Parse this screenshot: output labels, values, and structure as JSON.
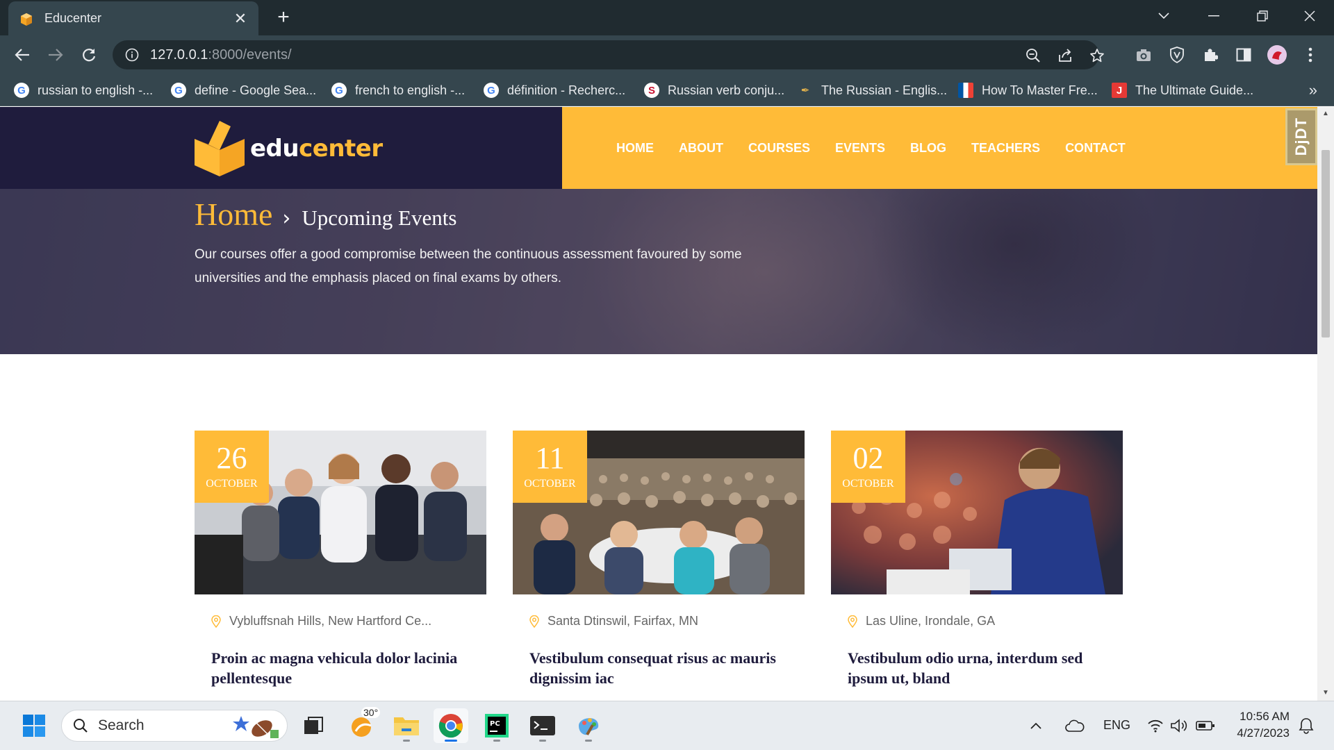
{
  "browser": {
    "tab_title": "Educenter",
    "url_host": "127.0.0.1",
    "url_path": ":8000/events/",
    "bookmarks": [
      {
        "label": "russian to english -...",
        "icon": "google-icon"
      },
      {
        "label": "define - Google Sea...",
        "icon": "google-icon"
      },
      {
        "label": "french to english -...",
        "icon": "google-icon"
      },
      {
        "label": "définition - Recherc...",
        "icon": "google-icon"
      },
      {
        "label": "Russian verb conju...",
        "icon": "reverso-icon"
      },
      {
        "label": "The Russian - Englis...",
        "icon": "pen-icon"
      },
      {
        "label": "How To Master Fre...",
        "icon": "french-flag-icon"
      },
      {
        "label": "The Ultimate Guide...",
        "icon": "j-icon"
      }
    ],
    "bookmarks_more": "»"
  },
  "site": {
    "logo_part1": "edu",
    "logo_part2": "center",
    "nav": [
      "HOME",
      "ABOUT",
      "COURSES",
      "EVENTS",
      "BLOG",
      "TEACHERS",
      "CONTACT"
    ],
    "djdt_label": "DjDT",
    "colors": {
      "primary": "#ffbb38",
      "dark": "#1f1c3d"
    }
  },
  "hero": {
    "crumb_home": "Home",
    "crumb_current": "Upcoming Events",
    "description": "Our courses offer a good compromise between the continuous assessment favoured by some universities and the emphasis placed on final exams by others."
  },
  "events": [
    {
      "day": "26",
      "month": "OCTOBER",
      "location": "Vybluffsnah Hills, New Hartford Ce...",
      "title": "Proin ac magna vehicula dolor lacinia pellentesque"
    },
    {
      "day": "11",
      "month": "OCTOBER",
      "location": "Santa Dtinswil, Fairfax, MN",
      "title": "Vestibulum consequat risus ac mauris dignissim iac"
    },
    {
      "day": "02",
      "month": "OCTOBER",
      "location": "Las Uline, Irondale, GA",
      "title": "Vestibulum odio urna, interdum sed ipsum ut, bland"
    }
  ],
  "taskbar": {
    "search_label": "Search",
    "weather_temp": "30°",
    "lang": "ENG",
    "time": "10:56 AM",
    "date": "4/27/2023"
  }
}
